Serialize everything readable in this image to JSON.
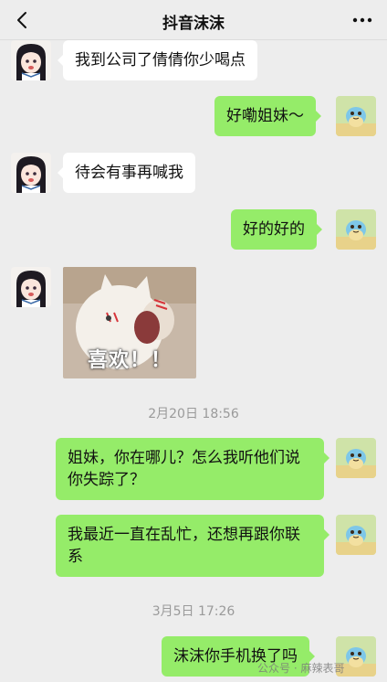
{
  "header": {
    "title": "抖音沫沫"
  },
  "messages": [
    {
      "text": "我到公司了倩倩你少喝点"
    },
    {
      "text": "好嘞姐妹～"
    },
    {
      "text": "待会有事再喊我"
    },
    {
      "text": "好的好的"
    },
    {
      "sticker_text": "喜欢！！"
    },
    {
      "text": "姐妹，你在哪儿？怎么我听他们说你失踪了？"
    },
    {
      "text": "我最近一直在乱忙，还想再跟你联系"
    },
    {
      "text": "沫沫你手机换了吗"
    }
  ],
  "timestamps": [
    "2月20日 18:56",
    "3月5日 17:26"
  ],
  "watermark": "公众号 · 麻辣表哥",
  "colors": {
    "background": "#ededed",
    "left_bubble": "#ffffff",
    "right_bubble": "#95ec69"
  },
  "icons": {
    "back": "chevron-left-icon",
    "more": "more-dots-icon"
  }
}
